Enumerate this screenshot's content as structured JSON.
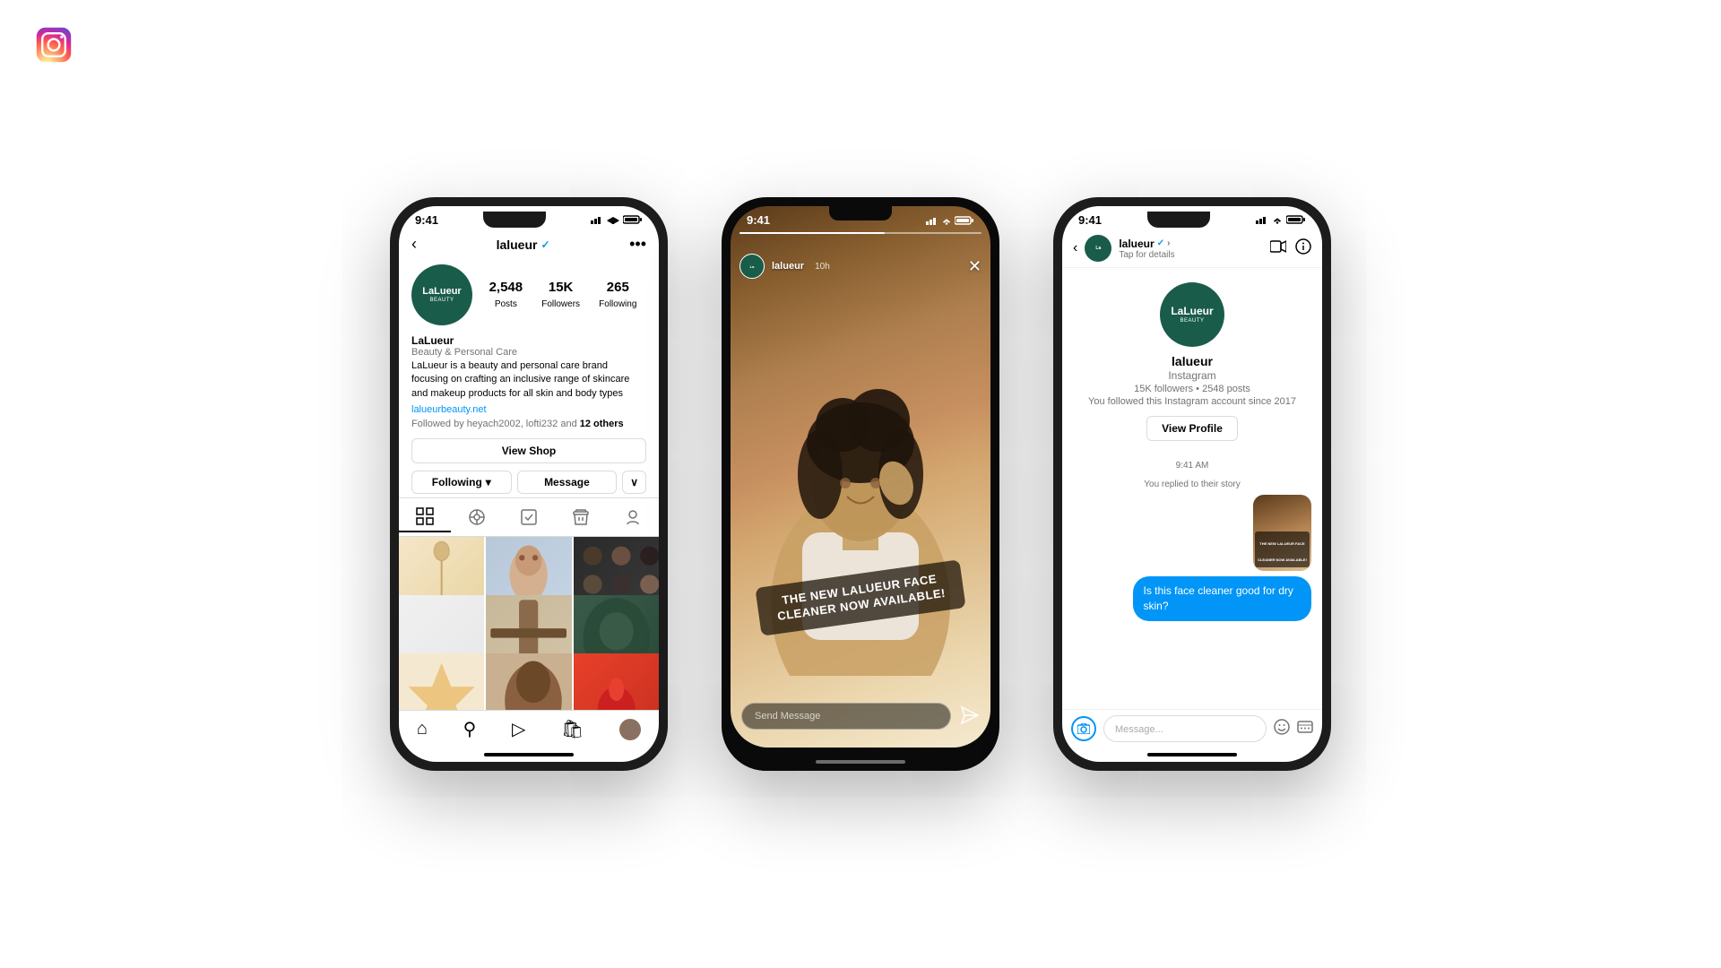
{
  "app": {
    "name": "Instagram"
  },
  "phone1": {
    "status_bar": {
      "time": "9:41",
      "signal": "▌▌▌",
      "wifi": "wifi",
      "battery": "battery"
    },
    "header": {
      "username": "lalueur",
      "verified": "✓",
      "more_icon": "•••",
      "back": "<"
    },
    "stats": {
      "posts_count": "2,548",
      "posts_label": "Posts",
      "followers_count": "15K",
      "followers_label": "Followers",
      "following_count": "265",
      "following_label": "Following"
    },
    "bio": {
      "name": "LaLueur",
      "category": "Beauty & Personal Care",
      "description": "LaLueur is a beauty and personal care brand focusing on crafting an inclusive range of skincare and makeup products for all skin and body types",
      "link": "lalueurbeauty.net",
      "followed_by": "Followed by heyach2002, lofti232 and",
      "followed_by_count": "12 others"
    },
    "buttons": {
      "view_shop": "View Shop",
      "following": "Following",
      "message": "Message",
      "more": "∨"
    },
    "bottom_nav": {
      "home": "⌂",
      "search": "⚲",
      "reels": "▷",
      "shop": "🛍",
      "profile": "👤"
    }
  },
  "phone2": {
    "status_bar": {
      "time": "9:41"
    },
    "story": {
      "username": "lalueur",
      "time_ago": "10h",
      "close": "✕",
      "text": "THE NEW LALUEUR FACE CLEANER NOW AVAILABLE!",
      "message_placeholder": "Send Message"
    }
  },
  "phone3": {
    "status_bar": {
      "time": "9:41"
    },
    "header": {
      "back": "<",
      "username": "lalueur",
      "verified": "✓",
      "subtitle": "Tap for details"
    },
    "profile": {
      "name": "lalueur",
      "platform": "Instagram",
      "stats": "15K followers • 2548 posts",
      "followed_since": "You followed this Instagram account since 2017"
    },
    "buttons": {
      "view_profile": "View Profile"
    },
    "messages": {
      "timestamp": "9:41 AM",
      "replied_text": "You replied to their story",
      "story_overlay": "THE NEW LALUEUR FACE CLEANER NOW AVAILABLE!",
      "bubble_text": "Is this face cleaner good for dry skin?"
    },
    "input": {
      "placeholder": "Message..."
    }
  }
}
